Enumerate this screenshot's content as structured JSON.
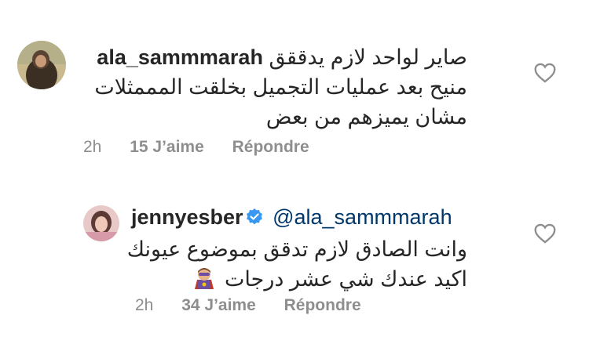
{
  "comments": [
    {
      "username": "ala_sammmarah",
      "lines": [
        "صاير لواحد لازم يدققق",
        "منيح  بعد عمليات التجميل بخلقت المممثلات",
        "مشان يميزهم من بعض"
      ],
      "time": "2h",
      "likes": "15 J’aime",
      "reply": "Répondre",
      "avatar_icon": "profile-photo",
      "like_icon": "heart-outline-icon"
    },
    {
      "username": "jennyesber",
      "verified_icon": "verified-badge-icon",
      "mention": "@ala_sammmarah",
      "lines": [
        "وانت الصادق لازم تدقق بموضوع عيونك",
        "اكيد  عندك شي عشر درجات"
      ],
      "emoji": "superhero-emoji",
      "time": "2h",
      "likes": "34 J’aime",
      "reply": "Répondre",
      "avatar_icon": "profile-photo",
      "like_icon": "heart-outline-icon"
    }
  ],
  "colors": {
    "text": "#262626",
    "meta": "#8e8e8e",
    "mention": "#00376b",
    "verified": "#3897f0"
  }
}
